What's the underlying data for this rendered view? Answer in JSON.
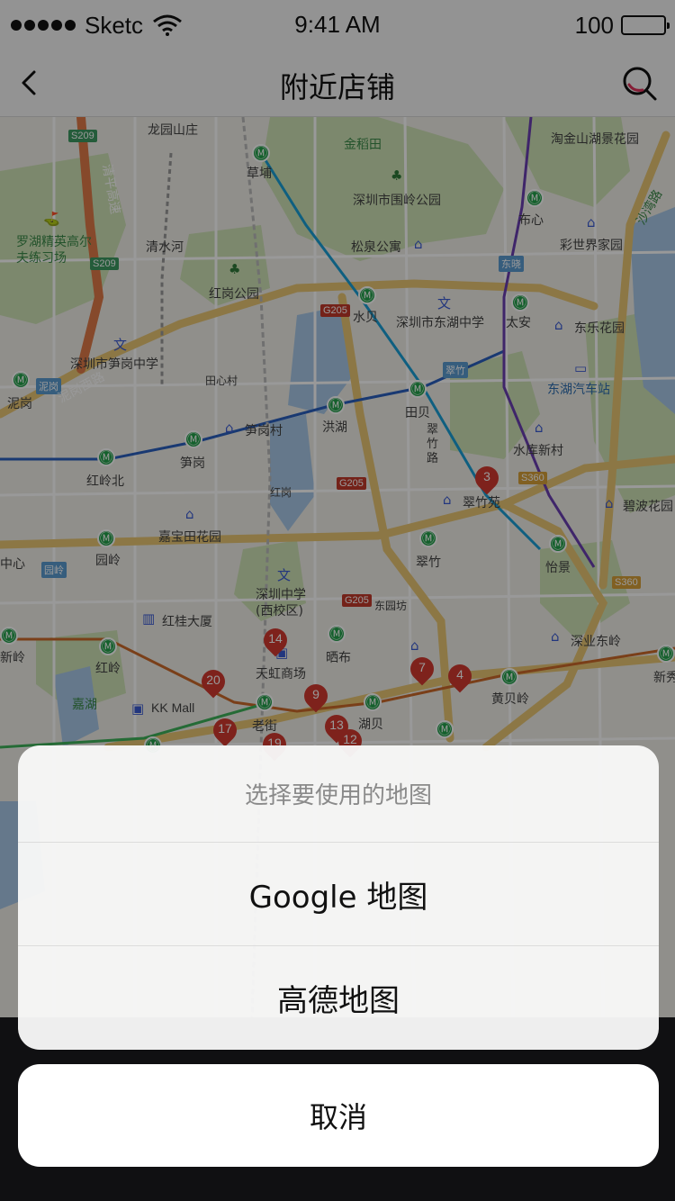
{
  "status_bar": {
    "carrier": "Sketc",
    "time": "9:41 AM",
    "battery": "100"
  },
  "nav": {
    "title": "附近店铺"
  },
  "map": {
    "labels": [
      "龙园山庄",
      "草埔",
      "金稻田",
      "深圳市围岭公园",
      "淘金山湖景花园",
      "布心",
      "罗湖精英高尔夫练习场",
      "清水河",
      "松泉公寓",
      "彩世界家园",
      "红岗公园",
      "水贝",
      "深圳市东湖中学",
      "太安",
      "东乐花园",
      "深圳市笋岗中学",
      "田心村",
      "东湖汽车站",
      "泥岗",
      "笋岗村",
      "洪湖",
      "田贝",
      "水库新村",
      "红岭北",
      "笋岗",
      "翠竹路",
      "翠竹苑",
      "碧波花园",
      "嘉宝田花园",
      "中心",
      "园岭",
      "翠竹",
      "怡景",
      "红桂大厦",
      "深圳中学(西校区)",
      "东园坊",
      "新岭",
      "红岭",
      "晒布",
      "深业东岭",
      "天虹商场",
      "湖贝",
      "黄贝岭",
      "嘉湖",
      "KK Mall",
      "老街",
      "新秀",
      "红岗",
      "洪湖"
    ],
    "road_badges": [
      "S209",
      "S209",
      "G205",
      "G205",
      "G205",
      "S360",
      "S360",
      "东晓",
      "翠竹",
      "泥岗",
      "园岭",
      "沙湾路",
      "泥岗西路",
      "清平高速"
    ],
    "pins": [
      "3",
      "14",
      "20",
      "7",
      "4",
      "9",
      "17",
      "13",
      "12",
      "19"
    ]
  },
  "sheet": {
    "title": "选择要使用的地图",
    "options": [
      "Google 地图",
      "高德地图"
    ],
    "cancel": "取消"
  }
}
